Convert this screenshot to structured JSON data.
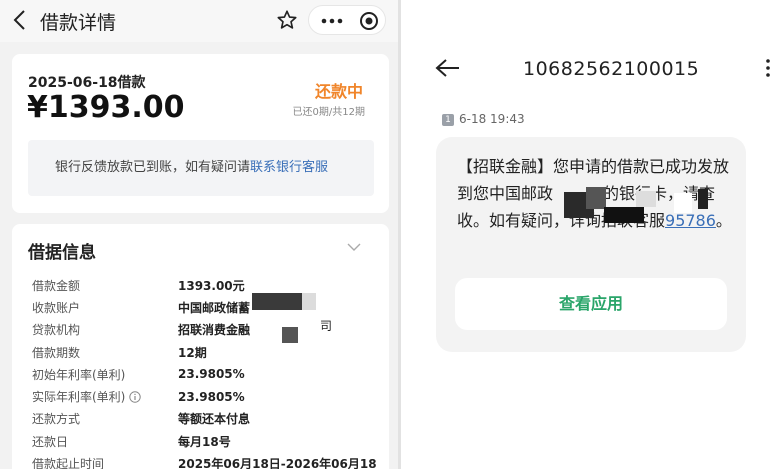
{
  "left": {
    "header": {
      "title": "借款详情"
    },
    "summary": {
      "date_label": "2025-06-18借款",
      "amount": "¥1393.00",
      "status": "还款中",
      "periods": "已还0期/共12期",
      "notice_text": "银行反馈放款已到账，如有疑问请",
      "notice_link": "联系银行客服"
    },
    "details": {
      "title": "借据信息",
      "rows": [
        {
          "label": "借款金额",
          "value": "1393.00元"
        },
        {
          "label": "收款账户",
          "value": "中国邮政储蓄"
        },
        {
          "label": "贷款机构",
          "value": "招联消费金融"
        },
        {
          "label": "借款期数",
          "value": "12期"
        },
        {
          "label": "初始年利率(单利)",
          "value": "23.9805%"
        },
        {
          "label": "实际年利率(单利)",
          "value": "23.9805%"
        },
        {
          "label": "还款方式",
          "value": "等额还本付息"
        },
        {
          "label": "还款日",
          "value": "每月18号"
        },
        {
          "label": "借款起止时间",
          "value": "2025年06月18日-2026年06月18"
        }
      ],
      "partial_suffix": "司"
    }
  },
  "right": {
    "sender": "10682562100015",
    "sim": "1",
    "time": "6-18 19:43",
    "message_part1": "【招联金融】您申请的借款已成功发放到您中国邮政",
    "message_part2": "的银行卡，请查收。如有疑问，详询招联客服",
    "message_number": "95786",
    "message_end": "。",
    "action_button": "查看应用"
  },
  "colors": {
    "status_orange": "#f0852a",
    "link_blue": "#3a6fb8",
    "action_green": "#2aa56a"
  }
}
